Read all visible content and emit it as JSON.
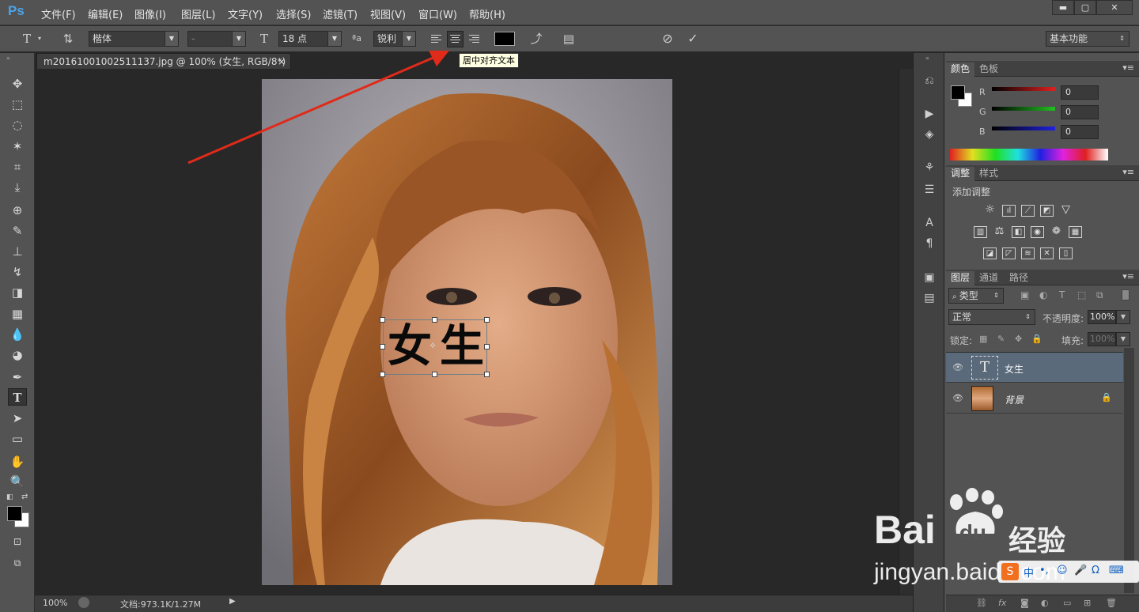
{
  "app": {
    "logo": "Ps"
  },
  "menu": [
    "文件(F)",
    "编辑(E)",
    "图像(I)",
    "图层(L)",
    "文字(Y)",
    "选择(S)",
    "滤镜(T)",
    "视图(V)",
    "窗口(W)",
    "帮助(H)"
  ],
  "window_controls": {
    "minimize": "▬",
    "maximize": "▢",
    "close": "✕"
  },
  "options": {
    "font_family": "楷体",
    "font_style": "-",
    "font_size": "18 点",
    "antialias": "锐利",
    "aa_label": "ªa",
    "workspace": "基本功能",
    "text_color": "#000000"
  },
  "tooltip": "居中对齐文本",
  "document": {
    "tab_title": "m20161001002511137.jpg @ 100% (女生, RGB/8*) *",
    "tab_close": "×",
    "text_layer_content": "女生"
  },
  "status": {
    "zoom": "100%",
    "doc_info": "文档:973.1K/1.27M"
  },
  "color_panel": {
    "tabs": [
      "颜色",
      "色板"
    ],
    "channels": [
      {
        "label": "R",
        "value": "0",
        "color": "#e02020"
      },
      {
        "label": "G",
        "value": "0",
        "color": "#20c020"
      },
      {
        "label": "B",
        "value": "0",
        "color": "#2020e0"
      }
    ]
  },
  "adjustments_panel": {
    "tabs": [
      "调整",
      "样式"
    ],
    "add_label": "添加调整"
  },
  "layers_panel": {
    "tabs": [
      "图层",
      "通道",
      "路径"
    ],
    "filter_kind": "类型",
    "blend_mode": "正常",
    "opacity_label": "不透明度:",
    "opacity_value": "100%",
    "lock_label": "锁定:",
    "fill_label": "填充:",
    "fill_value": "100%",
    "layers": [
      {
        "name": "女生",
        "type": "text",
        "selected": true
      },
      {
        "name": "背景",
        "type": "image",
        "locked": true
      }
    ]
  },
  "watermark": {
    "brand": "Bai",
    "brand2": "du",
    "site_cn": "经验",
    "url": "jingyan.baidu.com"
  }
}
